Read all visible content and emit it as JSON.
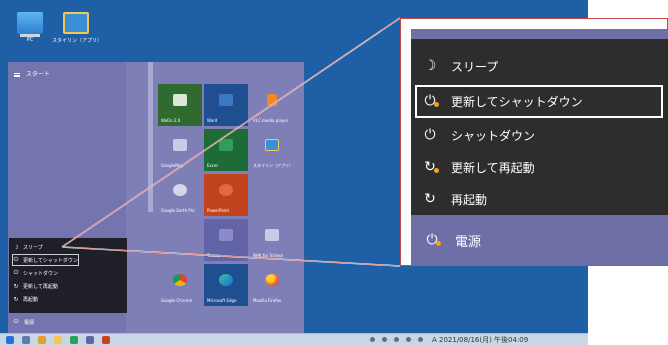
{
  "desktop": {
    "icons": [
      {
        "label": "PC",
        "icon": "pc-icon"
      },
      {
        "label": "スタイリン（アプリ）",
        "icon": "app-icon"
      }
    ]
  },
  "start_menu": {
    "title": "スタート",
    "tiles": [
      {
        "label": "WeDo 2.0",
        "color": "#2f6b2f",
        "icon": "wedo-icon"
      },
      {
        "label": "Word",
        "color": "#1f4f91",
        "icon": "word-icon"
      },
      {
        "label": "VLC media player",
        "color": "#7f7fb8",
        "icon": "vlc-icon"
      },
      {
        "label": "GoogleMap",
        "color": "#7f7fb8",
        "icon": "map-icon"
      },
      {
        "label": "Excel",
        "color": "#1e6b37",
        "icon": "excel-icon"
      },
      {
        "label": "スタイリン（アプリ）",
        "color": "#7f7fb8",
        "icon": "app-icon"
      },
      {
        "label": "Google Earth Pro",
        "color": "#7f7fb8",
        "icon": "earth-icon"
      },
      {
        "label": "PowerPoint",
        "color": "#c1441e",
        "icon": "powerpoint-icon"
      },
      {
        "label": "Teams",
        "color": "#6264a7",
        "icon": "teams-icon"
      },
      {
        "label": "NHK for School",
        "color": "#7f7fb8",
        "icon": "nhk-icon"
      },
      {
        "label": "Google Chrome",
        "color": "#7f7fb8",
        "icon": "chrome-icon"
      },
      {
        "label": "Microsoft Edge",
        "color": "#1f4f91",
        "icon": "edge-icon"
      },
      {
        "label": "Mozilla Firefox",
        "color": "#7f7fb8",
        "icon": "firefox-icon"
      }
    ],
    "power_popup": [
      {
        "label": "スリープ",
        "icon": "sleep-icon"
      },
      {
        "label": "更新してシャットダウン",
        "icon": "update-shutdown-icon"
      },
      {
        "label": "シャットダウン",
        "icon": "shutdown-icon"
      },
      {
        "label": "更新して再起動",
        "icon": "update-restart-icon"
      },
      {
        "label": "再起動",
        "icon": "restart-icon"
      }
    ],
    "power_label": "電源"
  },
  "zoom": {
    "items": [
      {
        "label": "スリープ"
      },
      {
        "label": "更新してシャットダウン"
      },
      {
        "label": "シャットダウン"
      },
      {
        "label": "更新して再起動"
      },
      {
        "label": "再起動"
      }
    ],
    "power_label": "電源",
    "selected_index": 1
  },
  "taskbar": {
    "date_time": "A 2021/08/16(月) 午後04:09"
  },
  "colors": {
    "desktop": "#1f5fa6",
    "start_menu": "#7f7fb8",
    "popup": "#1f1f2a",
    "callout": "#c84a4a"
  }
}
